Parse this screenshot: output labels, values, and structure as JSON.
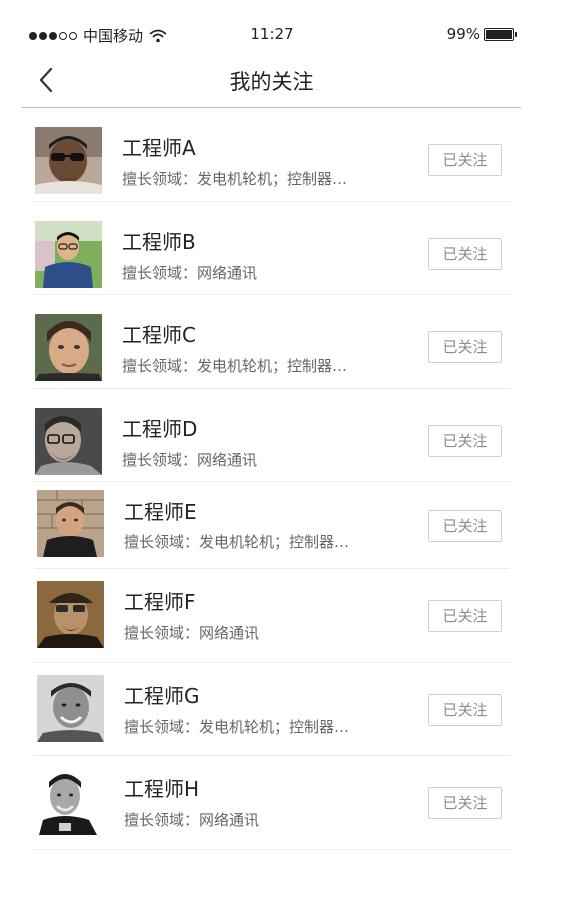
{
  "status_bar": {
    "carrier": "中国移动",
    "time": "11:27",
    "battery": "99%",
    "icons": [
      "signal-dots-icon",
      "wifi-icon",
      "battery-icon"
    ]
  },
  "nav": {
    "title": "我的关注",
    "back_icon": "chevron-left-icon"
  },
  "follow_label": "已关注",
  "engineers": [
    {
      "name": "工程师A",
      "field": "擅长领域：发电机轮机；控制器…",
      "avatar": "photo-sunglasses"
    },
    {
      "name": "工程师B",
      "field": "擅长领域：网络通讯",
      "avatar": "photo-outdoor-glasses"
    },
    {
      "name": "工程师C",
      "field": "擅长领域：发电机轮机；控制器…",
      "avatar": "photo-portrait"
    },
    {
      "name": "工程师D",
      "field": "擅长领域：网络通讯",
      "avatar": "photo-glasses-bw"
    },
    {
      "name": "工程师E",
      "field": "擅长领域：发电机轮机；控制器…",
      "avatar": "photo-stone-wall"
    },
    {
      "name": "工程师F",
      "field": "擅长领域：网络通讯",
      "avatar": "photo-sepia-cap"
    },
    {
      "name": "工程师G",
      "field": "擅长领域：发电机轮机；控制器…",
      "avatar": "photo-bw-smile"
    },
    {
      "name": "工程师H",
      "field": "擅长领域：网络通讯",
      "avatar": "photo-bw-tshirt"
    }
  ]
}
